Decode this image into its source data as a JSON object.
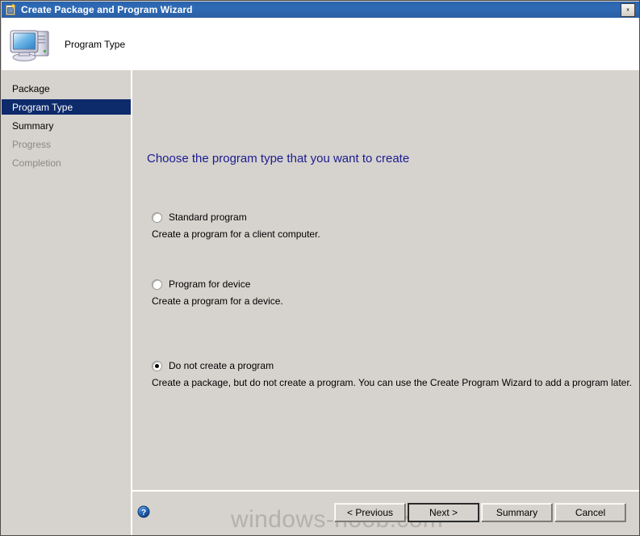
{
  "window": {
    "title": "Create Package and Program Wizard",
    "titlebar_icon": "package-star-icon",
    "close_label": "close-icon",
    "accent_titlebar": "#2f6bb5",
    "body_background": "#d6d3ce"
  },
  "header": {
    "title": "Program Type",
    "icon": "computer-icon"
  },
  "sidebar": {
    "items": [
      {
        "label": "Package",
        "state": "normal"
      },
      {
        "label": "Program Type",
        "state": "active"
      },
      {
        "label": "Summary",
        "state": "normal"
      },
      {
        "label": "Progress",
        "state": "disabled"
      },
      {
        "label": "Completion",
        "state": "disabled"
      }
    ],
    "active_color": "#0d2a6b",
    "disabled_color": "#8b8984"
  },
  "content": {
    "heading": "Choose the program type that you want to create",
    "heading_color": "#1b1b8f",
    "options": [
      {
        "label": "Standard program",
        "description": "Create a program for a client computer.",
        "selected": false
      },
      {
        "label": "Program for device",
        "description": "Create a program for a device.",
        "selected": false
      },
      {
        "label": "Do not create a program",
        "description": "Create a package, but do not create a program. You can use the Create Program Wizard to add a program later.",
        "selected": true
      }
    ]
  },
  "footer": {
    "help_icon": "help-circle-icon",
    "watermark": "windows-noob.com",
    "buttons": [
      {
        "label": "< Previous",
        "default": false
      },
      {
        "label": "Next >",
        "default": true
      },
      {
        "label": "Summary",
        "default": false
      },
      {
        "label": "Cancel",
        "default": false
      }
    ]
  }
}
